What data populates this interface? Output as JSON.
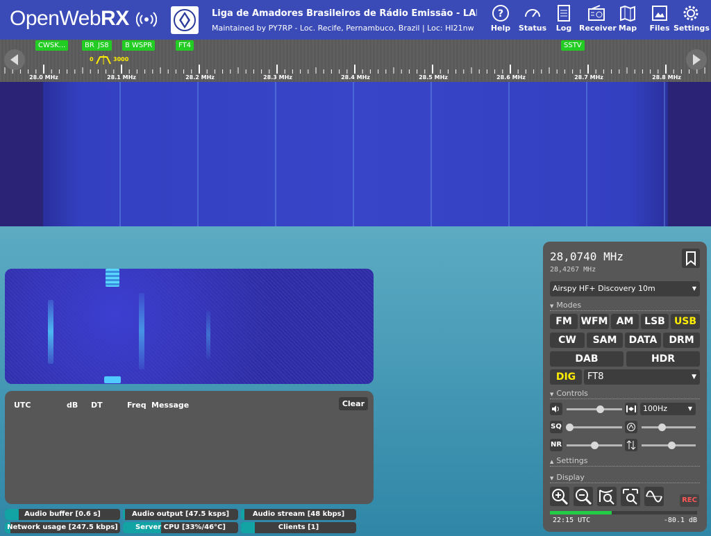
{
  "header": {
    "logo_text": "OpenWeb",
    "logo_bold": "RX",
    "title": "Liga de Amadores Brasileiros de Rádio Emissão - LABRE",
    "subtitle": "Maintained by PY7RP - Loc. Recife, Pernambuco, Brazil | Loc: HI21nw",
    "nav": [
      {
        "label": "Help",
        "icon": "help-icon"
      },
      {
        "label": "Status",
        "icon": "status-gauge-icon"
      },
      {
        "label": "Log",
        "icon": "log-icon"
      },
      {
        "label": "Receiver",
        "icon": "receiver-icon"
      },
      {
        "label": "Map",
        "icon": "map-icon"
      },
      {
        "label": "Files",
        "icon": "files-icon"
      },
      {
        "label": "Settings",
        "icon": "gear-icon"
      }
    ]
  },
  "scale": {
    "bookmarks": [
      "CWSK...",
      "BR",
      "JS8",
      "B",
      "WSPR",
      "FT4",
      "SSTV"
    ],
    "passband_low": "0",
    "passband_high": "3000",
    "tick_labels": [
      "28.0 MHz",
      "28.1 MHz",
      "28.2 MHz",
      "28.3 MHz",
      "28.4 MHz",
      "28.5 MHz",
      "28.6 MHz",
      "28.7 MHz",
      "28.8 MHz"
    ]
  },
  "messages": {
    "columns": [
      "UTC",
      "dB",
      "DT",
      "Freq",
      "Message"
    ],
    "clear_label": "Clear",
    "rows": []
  },
  "status": [
    {
      "label": "Audio buffer [0.6 s]",
      "fill": 0.12
    },
    {
      "label": "Audio output [47.5 ksps]",
      "fill": 0.02
    },
    {
      "label": "Audio stream [48 kbps]",
      "fill": 0.03
    },
    {
      "label": "Network usage [247.5 kbps]",
      "fill": 0.05
    },
    {
      "label": "Server CPU [33%/46°C]",
      "fill": 0.33
    },
    {
      "label": "Clients [1]",
      "fill": 0.12
    }
  ],
  "receiver": {
    "frequency": "28,0740 MHz",
    "center_frequency": "28,4267 MHz",
    "profile": "Airspy HF+ Discovery 10m",
    "sections": {
      "modes": "Modes",
      "controls": "Controls",
      "settings": "Settings",
      "display": "Display"
    },
    "modes_row1": [
      "FM",
      "WFM",
      "AM",
      "LSB",
      "USB"
    ],
    "modes_row2": [
      "CW",
      "SAM",
      "DATA",
      "DRM"
    ],
    "modes_row3": [
      "DAB",
      "HDR"
    ],
    "active_mode": "USB",
    "dig_label": "DIG",
    "dig_mode": "FT8",
    "sq_label": "SQ",
    "nr_label": "NR",
    "step": "100Hz",
    "volume_level": 0.6,
    "squelch_level": 0.05,
    "nr_level": 0.5,
    "rec_label": "REC",
    "time": "22:15 UTC",
    "level": "-80.1 dB",
    "smeter_fill": 0.42
  },
  "colors": {
    "header": "#3a4bb8",
    "panel": "#575757",
    "active": "#ffee00",
    "bookmark": "#22cc22",
    "status_fill": "#12a4a4"
  }
}
